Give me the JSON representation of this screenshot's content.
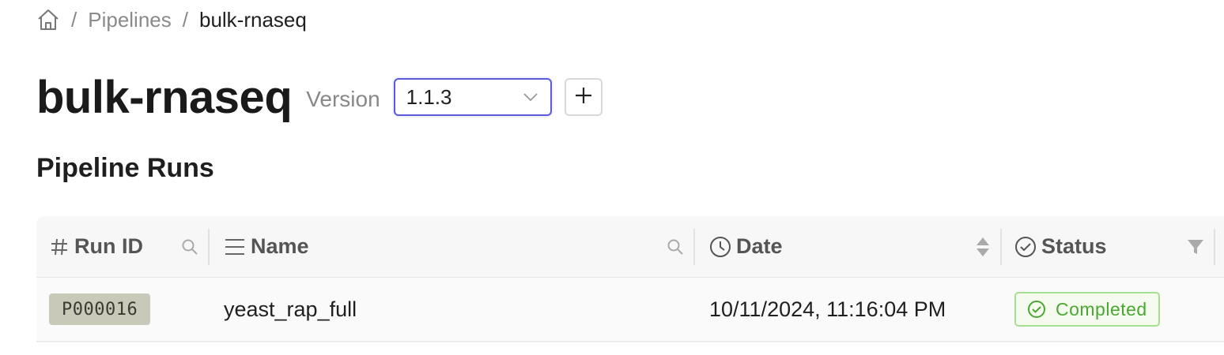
{
  "breadcrumb": {
    "home_icon": "home-icon",
    "separator": "/",
    "items": [
      "Pipelines",
      "bulk-rnaseq"
    ]
  },
  "header": {
    "title": "bulk-rnaseq",
    "version_label": "Version",
    "version_value": "1.1.3",
    "add_icon": "plus-icon"
  },
  "runs": {
    "section_title": "Pipeline Runs",
    "columns": [
      {
        "label": "Run ID",
        "icon": "hash-icon",
        "action": "search-icon"
      },
      {
        "label": "Name",
        "icon": "list-icon",
        "action": "search-icon"
      },
      {
        "label": "Date",
        "icon": "clock-icon",
        "action": "sort-icon"
      },
      {
        "label": "Status",
        "icon": "check-circle-icon",
        "action": "filter-icon"
      }
    ],
    "rows": [
      {
        "run_id": "P000016",
        "name": "yeast_rap_full",
        "date": "10/11/2024, 11:16:04 PM",
        "status": "Completed"
      }
    ]
  },
  "colors": {
    "accent": "#5a5ae0",
    "status_completed": "#4aa832",
    "run_id_badge_bg": "#c8c9b9"
  }
}
